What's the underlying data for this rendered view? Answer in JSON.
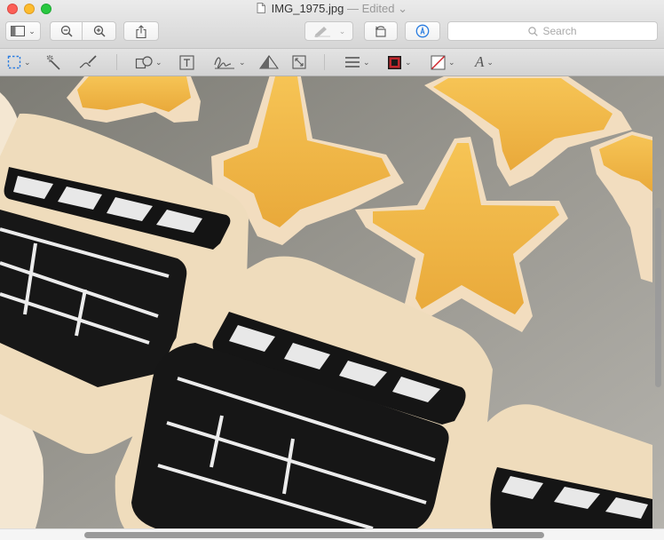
{
  "window": {
    "filename": "IMG_1975.jpg",
    "status": "— Edited"
  },
  "toolbar": {
    "search_placeholder": "Search"
  },
  "markup_toolbar": {
    "font_glyph": "A"
  },
  "colors": {
    "border_swatch": "#c0262c",
    "fill_swatch": "none",
    "accent": "#2a7de1"
  },
  "icons": [
    "sidebar-icon",
    "zoom-out-icon",
    "zoom-in-icon",
    "share-icon",
    "pen-icon",
    "rotate-icon",
    "markup-icon",
    "search-icon",
    "selection-icon",
    "instant-alpha-icon",
    "sketch-icon",
    "shapes-icon",
    "text-icon",
    "signature-icon",
    "adjust-color-icon",
    "adjust-size-icon",
    "shape-style-icon",
    "border-color-icon",
    "fill-color-icon",
    "text-style-icon"
  ]
}
